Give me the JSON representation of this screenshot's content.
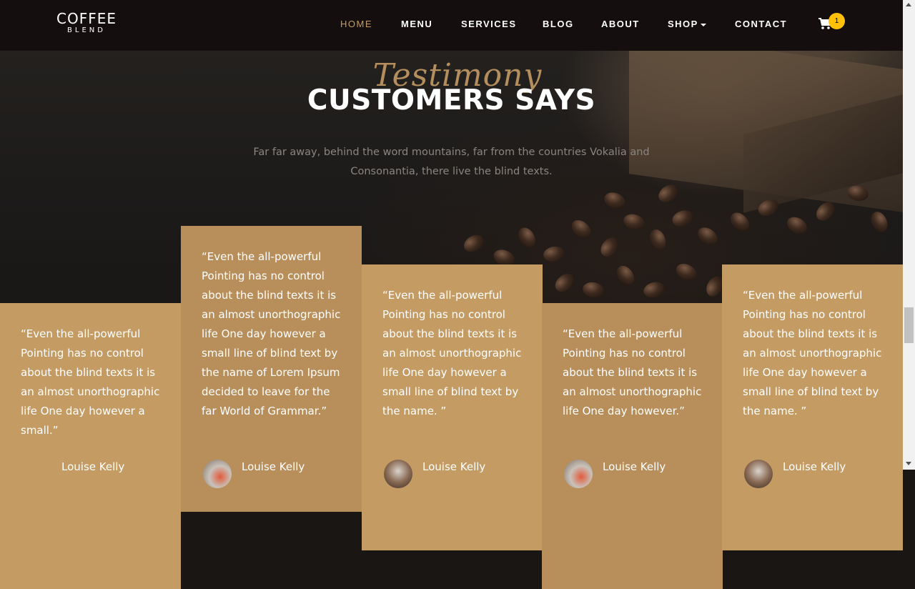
{
  "brand": {
    "line1": "COFFEE",
    "line2": "BLEND"
  },
  "nav": {
    "items": [
      {
        "label": "HOME",
        "active": true
      },
      {
        "label": "MENU"
      },
      {
        "label": "SERVICES"
      },
      {
        "label": "BLOG"
      },
      {
        "label": "ABOUT"
      },
      {
        "label": "SHOP",
        "dropdown": true
      },
      {
        "label": "CONTACT"
      }
    ],
    "cart": {
      "icon": "cart-icon",
      "count": "1"
    }
  },
  "section": {
    "subheading": "Testimony",
    "heading": "CUSTOMERS SAYS",
    "description": "Far far away, behind the word mountains, far from the countries Vokalia and Consonantia, there live the blind texts."
  },
  "testimonials": [
    {
      "quote": "“Even the all-powerful Pointing has no control about the blind texts it is an almost unorthographic life One day however a small.”",
      "author": "Louise Kelly"
    },
    {
      "quote": "“Even the all-powerful Pointing has no control about the blind texts it is an almost unorthographic life One day however a small line of blind text by the name of Lorem Ipsum decided to leave for the far World of Grammar.”",
      "author": "Louise Kelly"
    },
    {
      "quote": "“Even the all-powerful Pointing has no control about the blind texts it is an almost unorthographic life One day however a small line of blind text by the name. ”",
      "author": "Louise Kelly"
    },
    {
      "quote": "“Even the all-powerful Pointing has no control about the blind texts it is an almost unorthographic life One day however.”",
      "author": "Louise Kelly"
    },
    {
      "quote": "“Even the all-powerful Pointing has no control about the blind texts it is an almost unorthographic life One day however a small line of blind text by the name. ”",
      "author": "Louise Kelly"
    }
  ],
  "colors": {
    "accent": "#c49b63",
    "navbar": "#140f0e",
    "badge": "#ffc107"
  }
}
